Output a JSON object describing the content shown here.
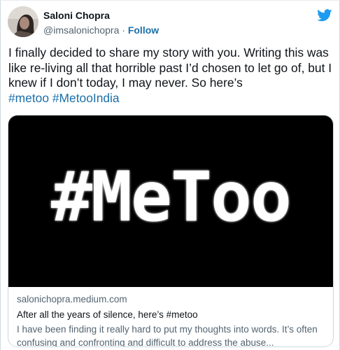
{
  "author": {
    "display_name": "Saloni Chopra",
    "handle": "@imsalonichopra",
    "separator": "·",
    "follow_label": "Follow"
  },
  "tweet": {
    "text": "I finally decided to share my story with you. Writing this was like re-living all that horrible past I’d chosen to let go of, but I knew if I don’t today, I may never. So here’s",
    "hashtags": [
      "#metoo",
      "#MetooIndia"
    ]
  },
  "card": {
    "image_text": "#MeToo",
    "domain": "salonichopra.medium.com",
    "title": "After all the years of silence, here’s #metoo",
    "description": "I have been finding it really hard to put my thoughts into words. It’s often confusing and confronting and difficult to address the abuse..."
  },
  "colors": {
    "link": "#1b6fa8",
    "twitter_blue": "#1d9bf0",
    "text": "#0f1419",
    "secondary": "#536471"
  },
  "icons": [
    "avatar",
    "twitter-bird-icon"
  ]
}
